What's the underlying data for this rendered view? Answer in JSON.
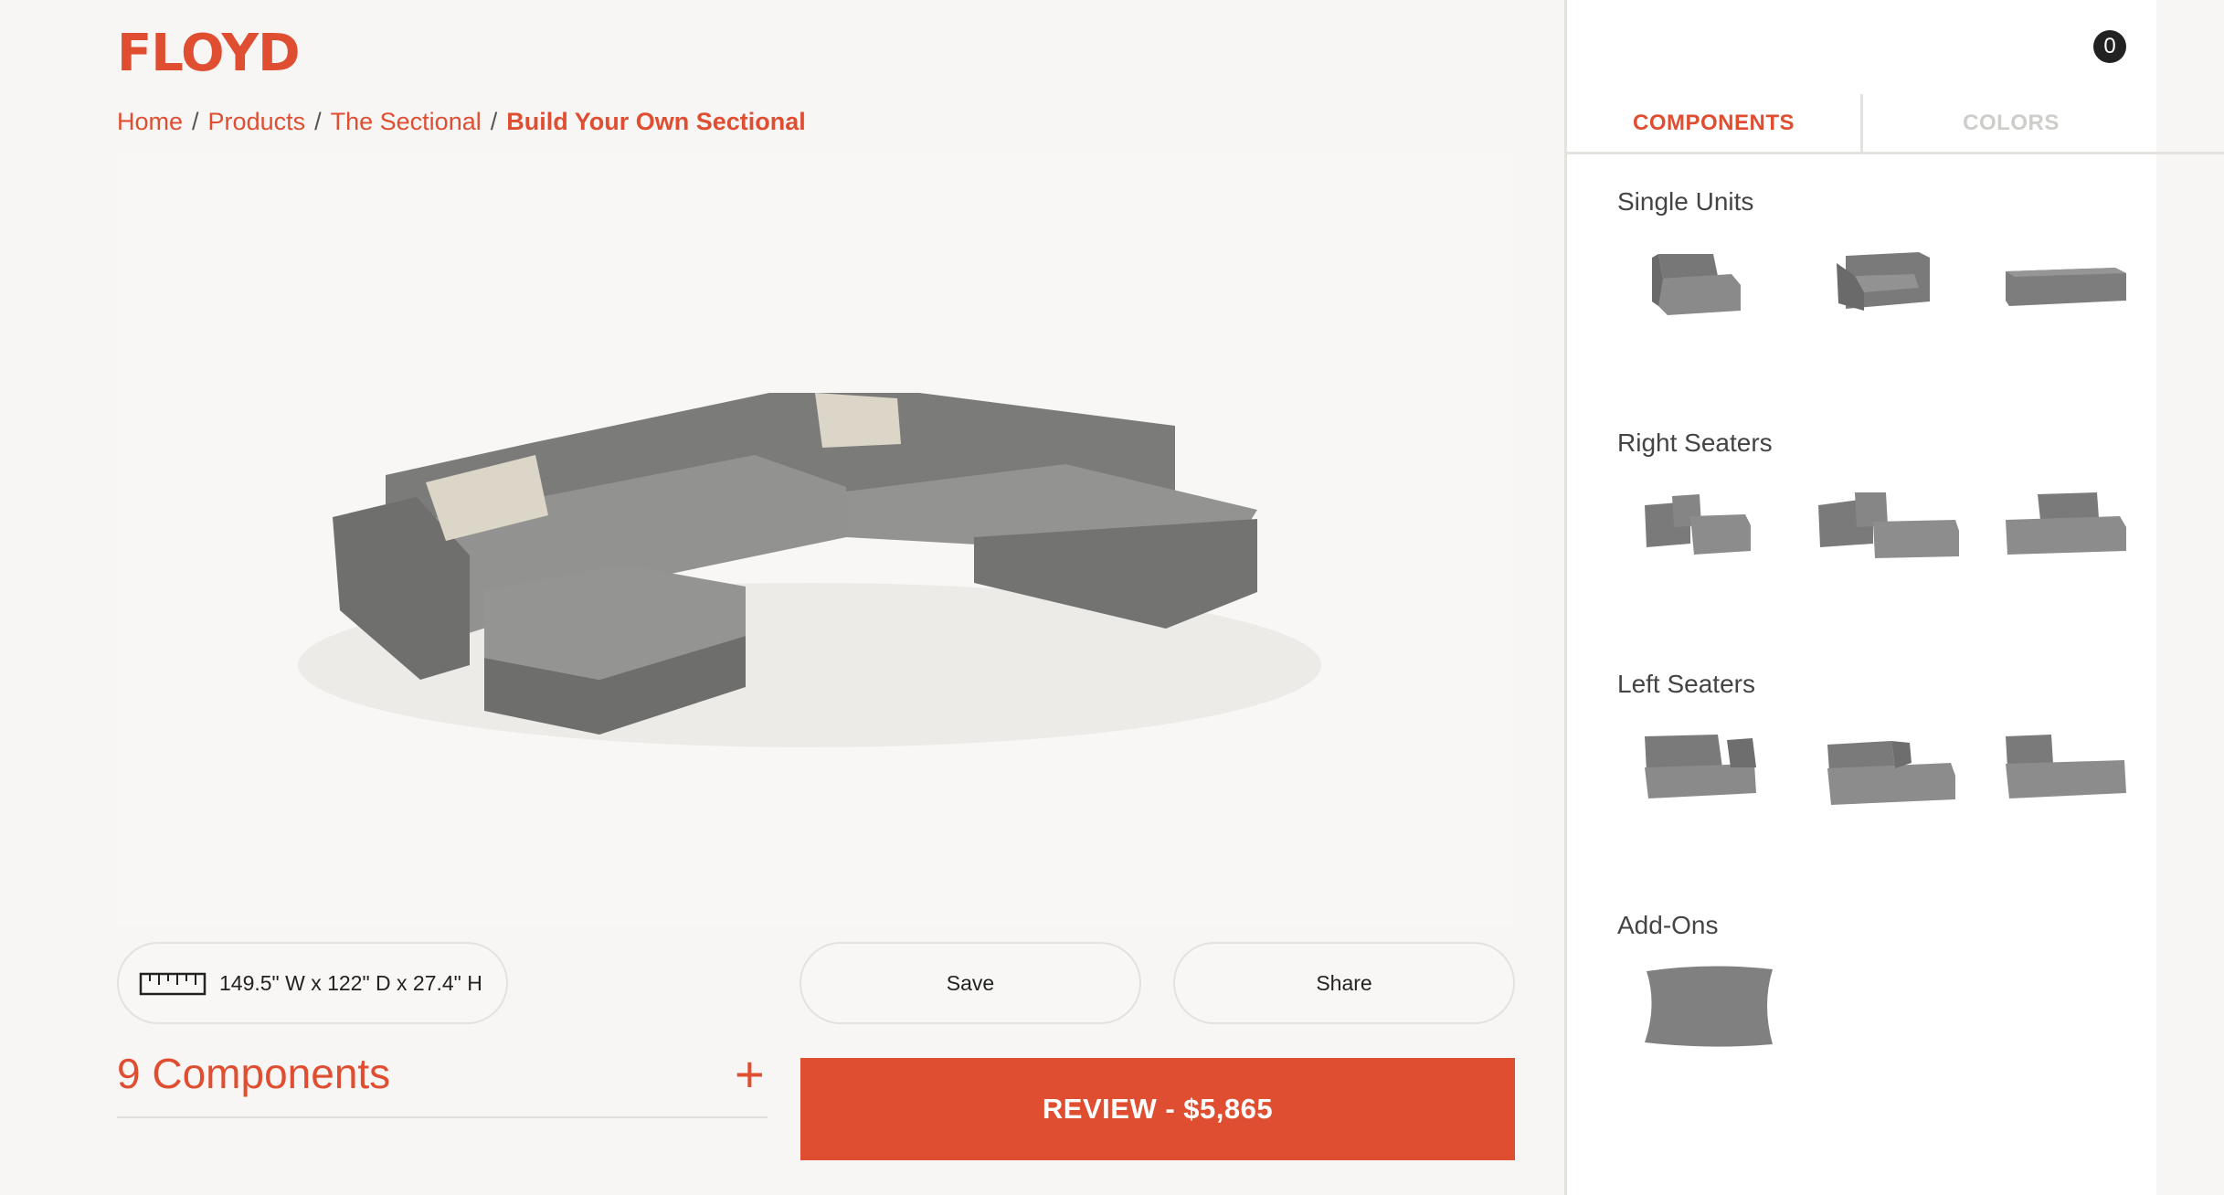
{
  "brand": {
    "logo": "FLOYD",
    "accent": "#e04e32"
  },
  "breadcrumb": {
    "home": "Home",
    "products": "Products",
    "sectional": "The Sectional",
    "current": "Build Your Own Sectional",
    "separator": "/"
  },
  "viewer": {
    "product": "3D sectional sofa preview"
  },
  "dimensions": {
    "icon": "ruler-icon",
    "text": "149.5\" W x 122\" D x 27.4\" H"
  },
  "actions": {
    "save_label": "Save",
    "share_label": "Share",
    "review_label": "REVIEW - $5,865"
  },
  "components": {
    "count_label": "9 Components",
    "expand_symbol": "+"
  },
  "sidebar": {
    "cart_count": "0",
    "tabs": [
      {
        "label": "COMPONENTS",
        "active": true
      },
      {
        "label": "COLORS",
        "active": false
      }
    ],
    "sections": [
      {
        "title": "Single Units",
        "items": [
          "armless-unit",
          "corner-unit",
          "ottoman-unit"
        ]
      },
      {
        "title": "Right Seaters",
        "items": [
          "right-arm-seater",
          "right-chaise-seater",
          "right-end-seater"
        ]
      },
      {
        "title": "Left Seaters",
        "items": [
          "left-arm-seater",
          "left-chaise-seater",
          "left-end-seater"
        ]
      },
      {
        "title": "Add-Ons",
        "items": [
          "throw-pillow"
        ]
      }
    ]
  }
}
